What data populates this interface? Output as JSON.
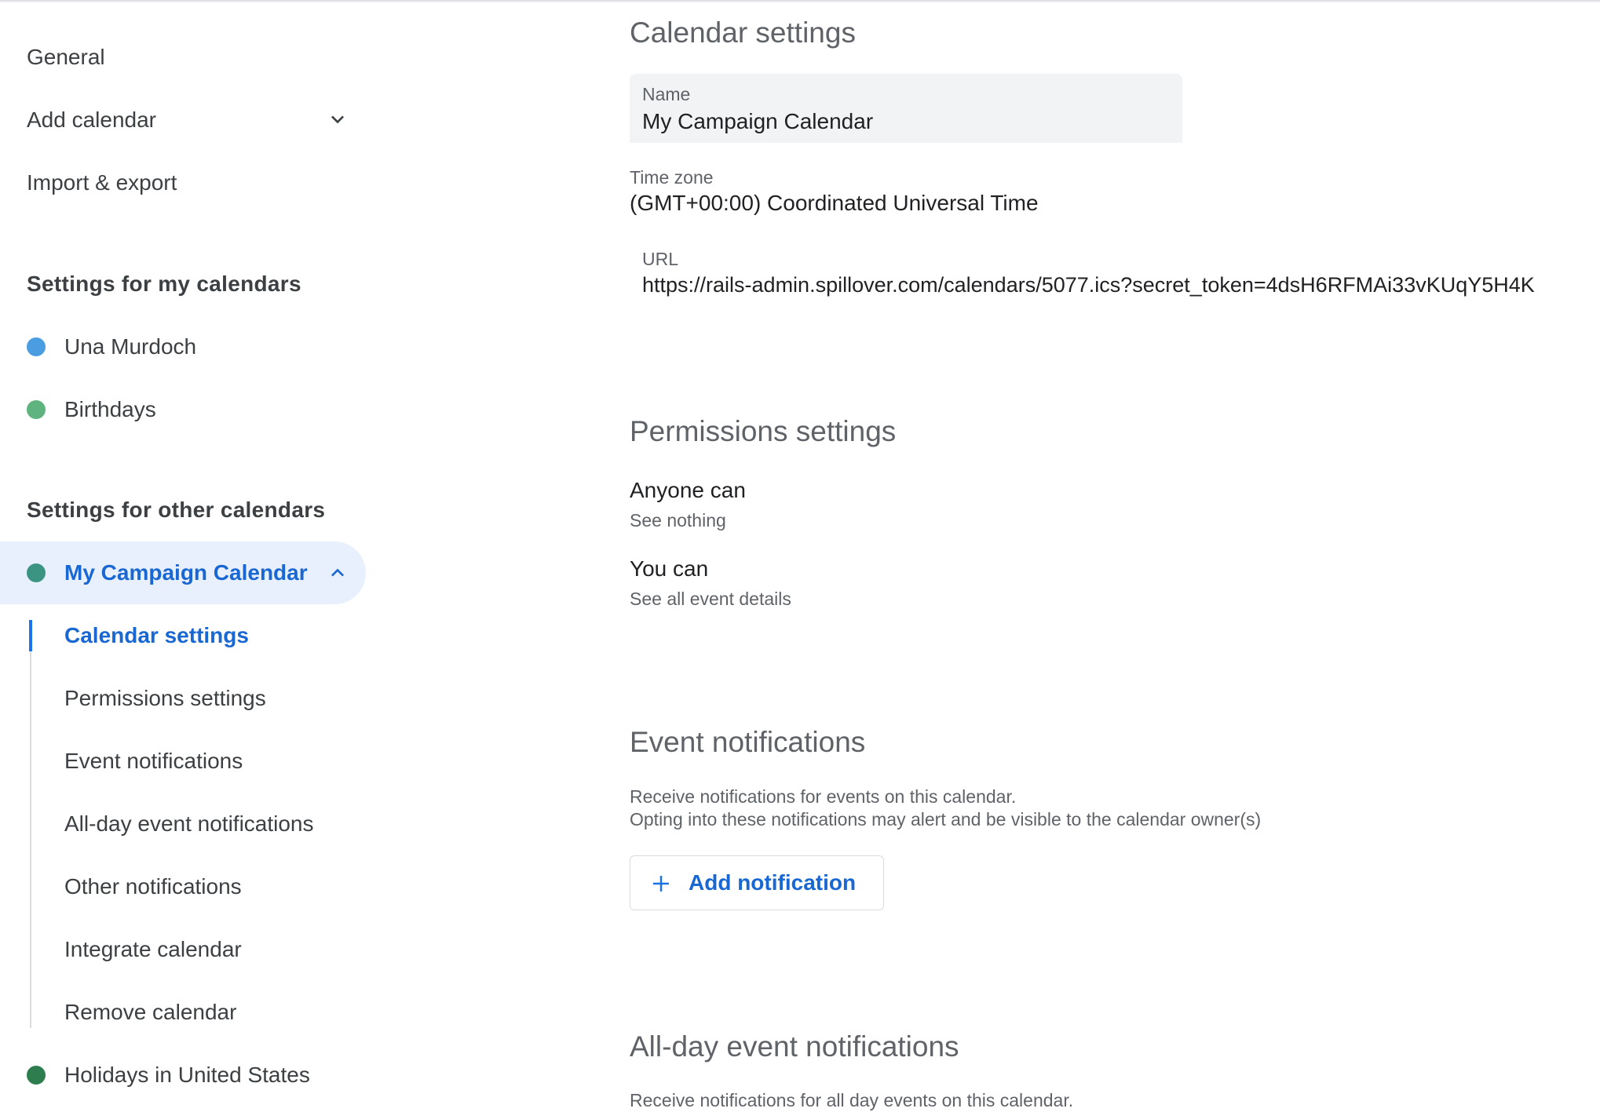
{
  "colors": {
    "accent": "#1a73e8",
    "active_text": "#1967d2",
    "active_bg": "#e8f0fe"
  },
  "sidebar": {
    "general": "General",
    "add_calendar": "Add calendar",
    "add_calendar_icon": "chevron-down-icon",
    "import_export": "Import & export",
    "my_calendars_heading": "Settings for my calendars",
    "my_calendars": [
      {
        "label": "Una Murdoch",
        "color": "#4a9de0"
      },
      {
        "label": "Birthdays",
        "color": "#5fb37e"
      }
    ],
    "other_calendars_heading": "Settings for other calendars",
    "selected_calendar": {
      "label": "My Campaign Calendar",
      "color": "#3b9482",
      "icon": "chevron-up-icon"
    },
    "subnav": [
      "Calendar settings",
      "Permissions settings",
      "Event notifications",
      "All-day event notifications",
      "Other notifications",
      "Integrate calendar",
      "Remove calendar"
    ],
    "holidays": {
      "label": "Holidays in United States",
      "color": "#2e7d4f"
    }
  },
  "main": {
    "calendar_settings": {
      "heading": "Calendar settings",
      "name_label": "Name",
      "name_value": "My Campaign Calendar",
      "timezone_label": "Time zone",
      "timezone_value": "(GMT+00:00) Coordinated Universal Time",
      "url_label": "URL",
      "url_value": "https://rails-admin.spillover.com/calendars/5077.ics?secret_token=4dsH6RFMAi33vKUqY5H4K"
    },
    "permissions": {
      "heading": "Permissions settings",
      "anyone_title": "Anyone can",
      "anyone_value": "See nothing",
      "you_title": "You can",
      "you_value": "See all event details"
    },
    "event_notifications": {
      "heading": "Event notifications",
      "desc_line1": "Receive notifications for events on this calendar.",
      "desc_line2": "Opting into these notifications may alert and be visible to the calendar owner(s)",
      "add_button": "Add notification",
      "add_icon": "plus-icon"
    },
    "allday_notifications": {
      "heading": "All-day event notifications",
      "desc_line1": "Receive notifications for all day events on this calendar."
    }
  }
}
